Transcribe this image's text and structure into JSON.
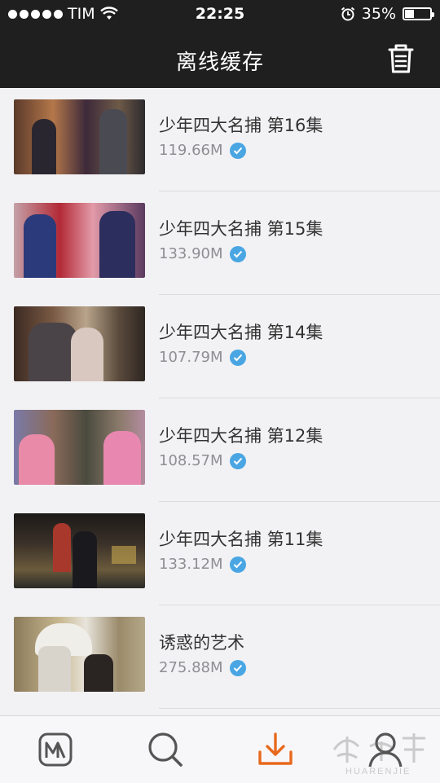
{
  "status_bar": {
    "carrier": "TIM",
    "time": "22:25",
    "battery_percent": "35%",
    "battery_level": 0.35
  },
  "header": {
    "title": "离线缓存",
    "right_icon": "trash-icon"
  },
  "downloads": [
    {
      "title": "少年四大名捕 第16集",
      "size": "119.66M",
      "status_icon": "check-icon"
    },
    {
      "title": "少年四大名捕 第15集",
      "size": "133.90M",
      "status_icon": "check-icon"
    },
    {
      "title": "少年四大名捕 第14集",
      "size": "107.79M",
      "status_icon": "check-icon"
    },
    {
      "title": "少年四大名捕 第12集",
      "size": "108.57M",
      "status_icon": "check-icon"
    },
    {
      "title": "少年四大名捕 第11集",
      "size": "133.12M",
      "status_icon": "check-icon"
    },
    {
      "title": "诱惑的艺术",
      "size": "275.88M",
      "status_icon": "check-icon"
    }
  ],
  "tabbar": {
    "tabs": [
      {
        "icon": "app-logo-icon",
        "active": false
      },
      {
        "icon": "search-icon",
        "active": false
      },
      {
        "icon": "download-icon",
        "active": true
      },
      {
        "icon": "profile-icon",
        "active": false
      }
    ],
    "active_color": "#e8691e",
    "inactive_color": "#555555"
  },
  "watermark": {
    "brand_text": "HUARENJIE"
  },
  "colors": {
    "bar_background": "#1f1f1f",
    "check_blue": "#4aa6e3"
  }
}
